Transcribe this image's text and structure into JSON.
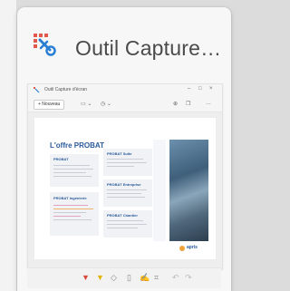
{
  "app": {
    "title": "Outil Capture…"
  },
  "thumbnail": {
    "mini_title": "Outil Capture d'écran",
    "new_button": "+ Nouveau",
    "document": {
      "heading": "L'offre PROBAT",
      "boxes": [
        {
          "title": "PROBAT"
        },
        {
          "title": "PROBAT Suite"
        },
        {
          "title": "PROBAT Ingénierie"
        },
        {
          "title": "PROBAT Entreprise"
        },
        {
          "title": "PROBAT Chantier"
        }
      ],
      "logo_text": "apris"
    }
  },
  "icons": {
    "app": "snipping-tool-icon",
    "toolbar": [
      "pen-icon",
      "highlighter-icon",
      "eraser-icon",
      "ruler-icon",
      "touch-write-icon",
      "crop-icon",
      "undo-icon",
      "redo-icon"
    ]
  },
  "colors": {
    "accent_red": "#d94a3a",
    "accent_blue": "#2a7fd4",
    "doc_blue": "#2a5b9a"
  }
}
